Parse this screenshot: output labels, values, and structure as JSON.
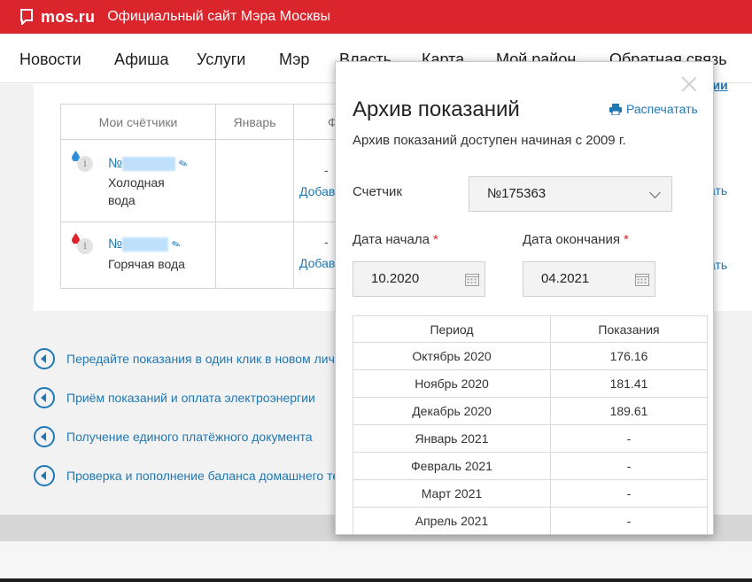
{
  "header": {
    "brand": "mos.ru",
    "subtitle": "Официальный сайт Мэра Москвы"
  },
  "nav": {
    "items": [
      {
        "label": "Новости"
      },
      {
        "label": "Афиша"
      },
      {
        "label": "Услуги"
      },
      {
        "label": "Мэр"
      },
      {
        "label": "Власть"
      },
      {
        "label": "Карта"
      },
      {
        "label": "Мой район"
      },
      {
        "label": "Обратная связь"
      }
    ]
  },
  "top_right_link": "нии",
  "meters": {
    "headers": [
      "Мои счётчики",
      "Январь",
      "Февраль"
    ],
    "header_partial": "Фев",
    "rows": [
      {
        "number_prefix": "№",
        "label": "Холодная вода",
        "label_line1": "Холодная",
        "label_line2": "вода",
        "icon": "water-drop-blue-icon"
      },
      {
        "number_prefix": "№",
        "label": "Горячая вода",
        "icon": "water-drop-red-icon"
      }
    ],
    "dash": "-",
    "add_link_partial": "Добав",
    "right_link_partial": "ать"
  },
  "links": [
    {
      "text": "Передайте показания в один клик в новом лич"
    },
    {
      "text": "Приём показаний и оплата электроэнергии"
    },
    {
      "text": "Получение единого платёжного документа"
    },
    {
      "text": "Проверка и пополнение баланса домашнего те"
    }
  ],
  "modal": {
    "title": "Архив показаний",
    "print_label": "Распечатать",
    "subtitle": "Архив показаний доступен начиная с 2009 г.",
    "meter_label": "Счетчик",
    "meter_value": "№175363",
    "start_label": "Дата начала",
    "start_value": "10.2020",
    "end_label": "Дата окончания",
    "end_value": "04.2021",
    "required_mark": "*",
    "table": {
      "headers": [
        "Период",
        "Показания"
      ],
      "rows": [
        [
          "Октябрь 2020",
          "176.16"
        ],
        [
          "Ноябрь 2020",
          "181.41"
        ],
        [
          "Декабрь 2020",
          "189.61"
        ],
        [
          "Январь 2021",
          "-"
        ],
        [
          "Февраль 2021",
          "-"
        ],
        [
          "Март 2021",
          "-"
        ],
        [
          "Апрель 2021",
          "-"
        ]
      ]
    }
  },
  "colors": {
    "brand_red": "#d9252b",
    "link_blue": "#1f78b4"
  }
}
